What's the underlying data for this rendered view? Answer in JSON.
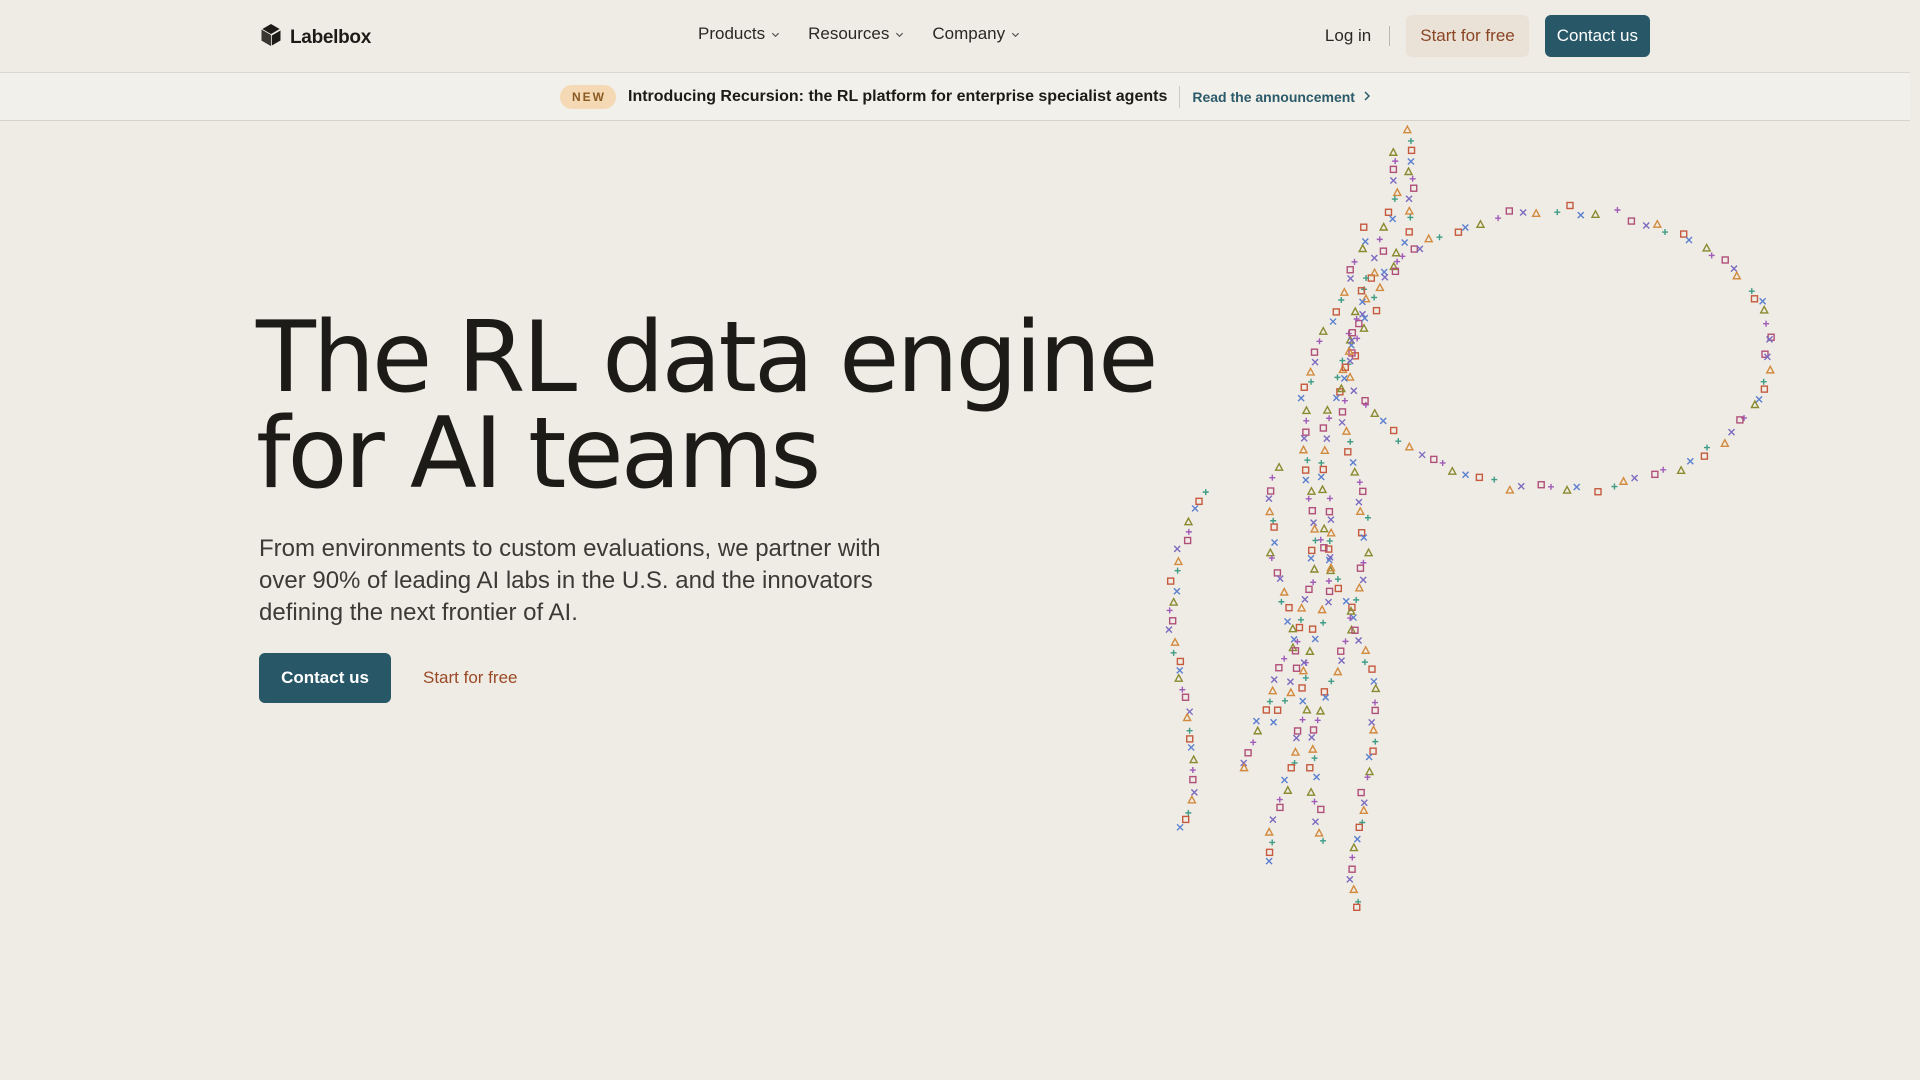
{
  "brand": {
    "name": "Labelbox",
    "logo_icon": "hexagon-cube-icon"
  },
  "nav": {
    "items": [
      {
        "label": "Products",
        "icon": "chevron-down-icon"
      },
      {
        "label": "Resources",
        "icon": "chevron-down-icon"
      },
      {
        "label": "Company",
        "icon": "chevron-down-icon"
      }
    ]
  },
  "header_actions": {
    "login": "Log in",
    "start_free": "Start for free",
    "contact": "Contact us"
  },
  "announcement": {
    "badge": "NEW",
    "text": "Introducing Recursion: the RL platform for enterprise specialist agents",
    "link": "Read the announcement",
    "link_icon": "chevron-right-icon"
  },
  "hero": {
    "title_line1": "The RL data engine",
    "title_line2": "for AI teams",
    "subtitle": "From environments to custom evaluations, we partner with over 90% of leading AI labs in the U.S. and the innovators defining the next frontier of AI.",
    "contact": "Contact us",
    "start_free": "Start for free"
  },
  "colors": {
    "background": "#efece5",
    "primary": "#285767",
    "accent": "#9a4a26",
    "badge_bg": "#f4d9b4"
  }
}
